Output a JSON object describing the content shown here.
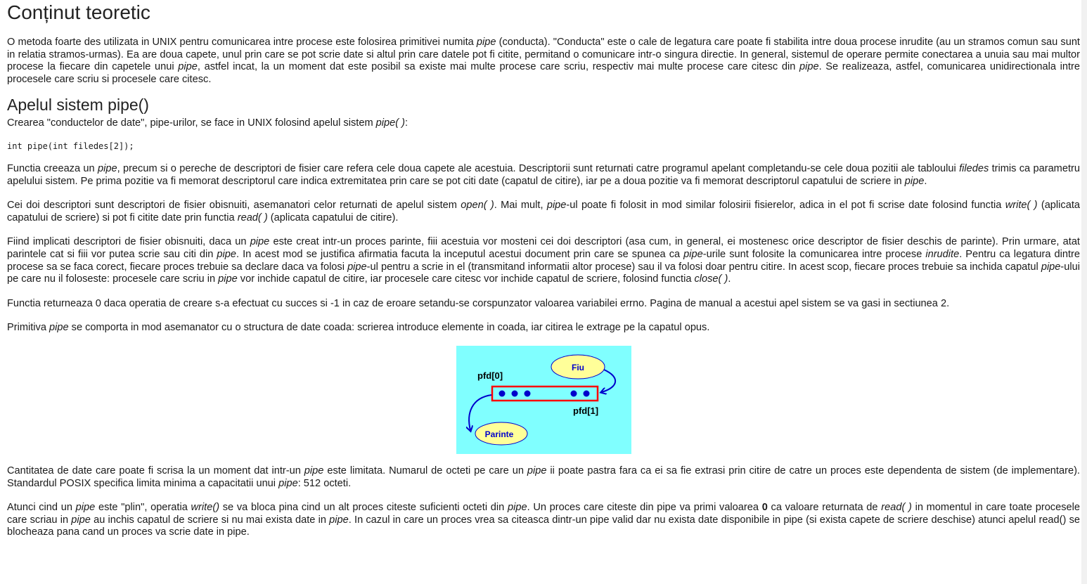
{
  "title": "Conținut teoretic",
  "p1": {
    "a": "O metoda foarte des utilizata in UNIX pentru comunicarea intre procese este folosirea primitivei numita ",
    "b": "pipe",
    "c": " (conducta). \"Conducta\" este o cale de legatura care poate fi stabilita intre doua procese inrudite (au un stramos comun sau sunt in relatia stramos-urmas). Ea are doua capete, unul prin care se pot scrie date si altul prin care datele pot fi citite, permitand o comunicare intr-o singura directie. In general, sistemul de operare permite conectarea a unuia sau mai multor procese la fiecare din capetele unui ",
    "d": "pipe",
    "e": ", astfel incat, la un moment dat este posibil sa existe mai multe procese care scriu, respectiv mai multe procese care citesc din ",
    "f": "pipe",
    "g": ". Se realizeaza, astfel, comunicarea unidirectionala intre procesele care scriu si procesele care citesc."
  },
  "subtitle": "Apelul sistem pipe()",
  "p2": {
    "a": "Crearea \"conductelor de date\", pipe-urilor, se face in UNIX folosind apelul sistem ",
    "b": "pipe( )",
    "c": ":"
  },
  "code": "int pipe(int filedes[2]);",
  "p3": {
    "a": "Functia creeaza un ",
    "b": "pipe",
    "c": ", precum si o pereche de descriptori de fisier care refera cele doua capete ale acestuia. Descriptorii sunt returnati catre programul apelant completandu-se cele doua pozitii ale tabloului ",
    "d": "filedes",
    "e": " trimis ca parametru apelului sistem. Pe prima pozitie va fi memorat descriptorul care indica extremitatea prin care se pot citi date (capatul de citire), iar pe a doua pozitie va fi memorat descriptorul capatului de scriere in ",
    "f": "pipe",
    "g": "."
  },
  "p4": {
    "a": "Cei doi descriptori sunt descriptori de fisier obisnuiti, asemanatori celor returnati de apelul sistem ",
    "b": "open( )",
    "c": ". Mai mult, ",
    "d": "pipe",
    "e": "-ul poate fi folosit in mod similar folosirii fisierelor, adica in el pot fi scrise date folosind functia ",
    "f": "write( )",
    "g": " (aplicata capatului de scriere) si pot fi citite date prin functia ",
    "h": "read( )",
    "i": " (aplicata capatului de citire)."
  },
  "p5": {
    "a": "Fiind implicati descriptori de fisier obisnuiti, daca un ",
    "b": "pipe",
    "c": " este creat intr-un proces parinte, fiii acestuia vor mosteni cei doi descriptori (asa cum, in general, ei mostenesc orice descriptor de fisier deschis de parinte). Prin urmare, atat parintele cat si fiii vor putea scrie sau citi din ",
    "d": "pipe",
    "e": ". In acest mod se justifica afirmatia facuta la inceputul acestui document prin care se spunea ca ",
    "f": "pipe",
    "g": "-urile sunt folosite la comunicarea intre procese ",
    "h": "inrudite",
    "i": ". Pentru ca legatura dintre procese sa se faca corect, fiecare proces trebuie sa declare daca va folosi ",
    "j": "pipe",
    "k": "-ul pentru a scrie in el (transmitand informatii altor procese) sau il va folosi doar pentru citire. In acest scop, fiecare proces trebuie sa inchida capatul ",
    "l": "pipe",
    "m": "-ului pe care nu il foloseste: procesele care scriu in ",
    "n": "pipe",
    "o": " vor inchide capatul de citire, iar procesele care citesc vor inchide capatul de scriere, folosind functia ",
    "p": "close( )",
    "q": "."
  },
  "p6": "Functia returneaza 0 daca operatia de creare s-a efectuat cu succes si -1 in caz de eroare setandu-se corspunzator valoarea variabilei errno. Pagina de manual a acestui apel sistem se va gasi in sectiunea 2.",
  "p7": {
    "a": "Primitiva ",
    "b": "pipe",
    "c": " se comporta in mod asemanator cu o structura de date coada: scrierea introduce elemente in coada, iar citirea le extrage pe la capatul opus."
  },
  "figure": {
    "child_label": "Fiu",
    "parent_label": "Parinte",
    "read_end_label": "pfd[0]",
    "write_end_label": "pfd[1]",
    "colors": {
      "background": "#80ffff",
      "oval": "#ffff99",
      "pipe_border": "#ff0000",
      "arrows": "#0000cc"
    }
  },
  "p8": {
    "a": "Cantitatea de date care poate fi scrisa la un moment dat intr-un ",
    "b": "pipe",
    "c": " este limitata. Numarul de octeti pe care un ",
    "d": "pipe",
    "e": " ii poate pastra fara ca ei sa fie extrasi prin citire de catre un proces este dependenta de sistem (de implementare). Standardul POSIX specifica limita minima a capacitatii unui ",
    "f": "pipe",
    "g": ": 512 octeti."
  },
  "p9": {
    "a": "Atunci cind un ",
    "b": "pipe",
    "c": " este \"plin\", operatia ",
    "d": "write()",
    "e": " se va bloca pina cind un alt proces citeste suficienti octeti din ",
    "f": "pipe",
    "g": ". Un proces care citeste din pipe va primi valoarea ",
    "h": "0",
    "i": " ca valoare returnata de ",
    "j": "read( )",
    "k": " in momentul in care toate procesele care scriau in ",
    "l": "pipe",
    "m": " au inchis capatul de scriere si nu mai exista date in ",
    "n": "pipe",
    "o": ". In cazul in care un proces vrea sa citeasca dintr-un pipe valid dar nu exista date disponibile in pipe (si exista capete de scriere deschise) atunci apelul read() se blocheaza pana cand un proces va scrie date in pipe."
  }
}
